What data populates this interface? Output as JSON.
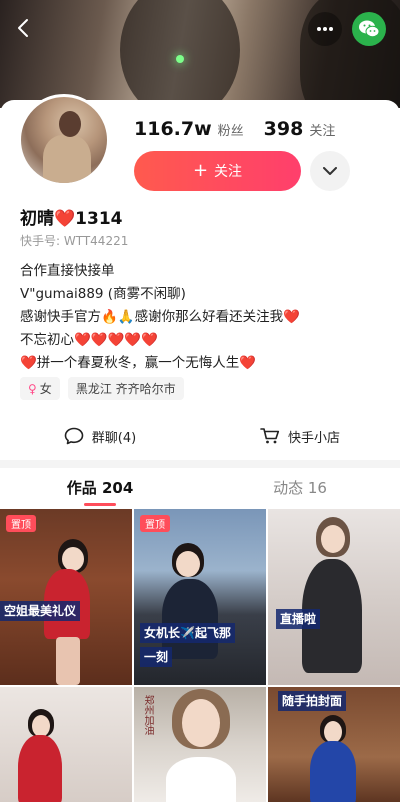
{
  "header": {
    "back_icon": "chevron-left-icon",
    "more_icon": "more-dots-icon",
    "share_icon": "wechat-icon",
    "share_color": "#2bb24c"
  },
  "profile": {
    "followers_count": "116.7w",
    "followers_label": "粉丝",
    "following_count": "398",
    "following_label": "关注",
    "follow_button_plus": "+",
    "follow_button_label": "关注",
    "name": "初晴❤️1314",
    "kuaishou_id": "快手号: WTT44221",
    "bio_lines": [
      "合作直接快接单",
      "V\"gumai889 (商雾不闲聊)",
      "感谢快手官方🔥🙏感谢你那么好看还关注我❤️",
      "不忘初心❤️❤️❤️❤️❤️",
      "❤️拼一个春夏秋冬，赢一个无悔人生❤️"
    ],
    "tag_gender_symbol": "♀",
    "tag_gender": "女",
    "tag_location": "黑龙江 齐齐哈尔市",
    "accent_color": "#ff4d5a"
  },
  "actions": {
    "group_chat_label": "群聊(4)",
    "shop_label": "快手小店"
  },
  "tabs": {
    "works_label": "作品 204",
    "moments_label": "动态 16"
  },
  "grid": {
    "tiles": [
      {
        "pin": "置顶",
        "overlay": "空姐最美礼仪"
      },
      {
        "pin": "置顶",
        "overlay_line1": "女机长✈️起飞那",
        "overlay_line2": "一刻"
      },
      {
        "overlay": "直播啦"
      },
      {},
      {
        "caption": "郑州加油"
      },
      {
        "overlay": "随手拍封面"
      }
    ]
  }
}
